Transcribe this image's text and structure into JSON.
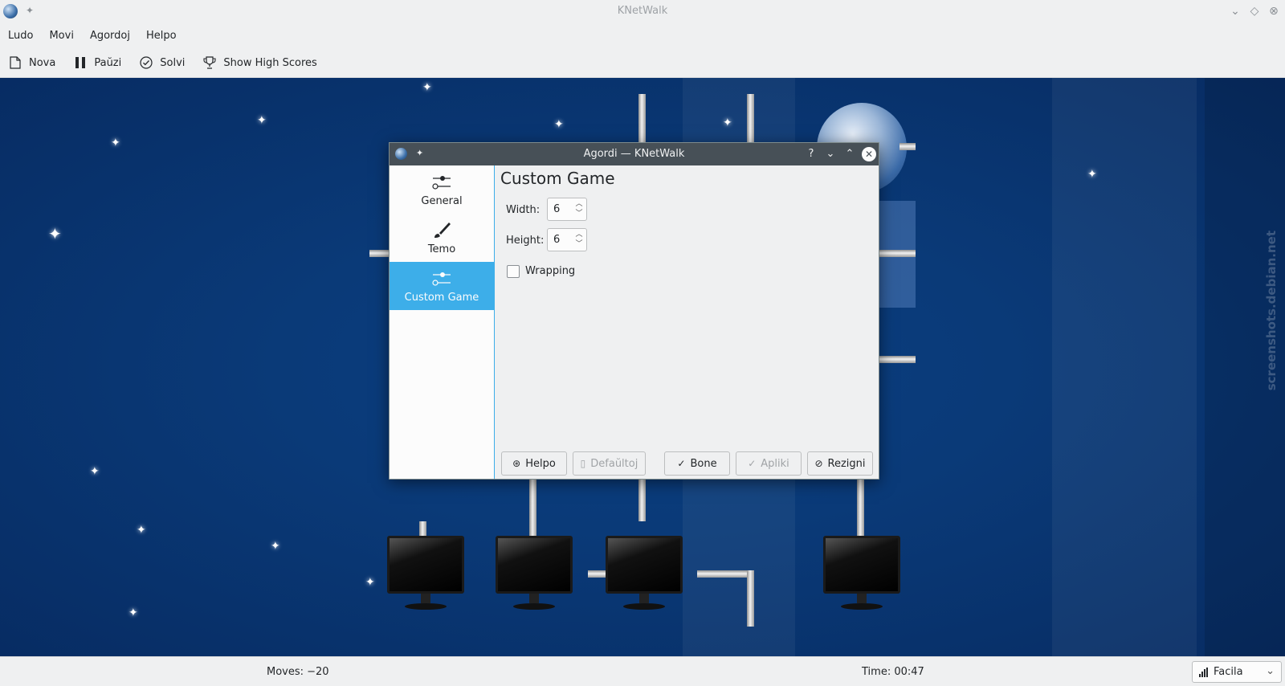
{
  "window": {
    "title": "KNetWalk"
  },
  "menubar": {
    "items": [
      "Ludo",
      "Movi",
      "Agordoj",
      "Helpo"
    ]
  },
  "toolbar": {
    "new_label": "Nova",
    "pause_label": "Paŭzi",
    "solve_label": "Solvi",
    "highscores_label": "Show High Scores"
  },
  "status": {
    "moves": "Moves: −20",
    "time": "Time: 00:47",
    "difficulty": "Facila"
  },
  "watermark": "screenshots.debian.net",
  "dialog": {
    "title": "Agordi — KNetWalk",
    "sidebar": [
      "General",
      "Temo",
      "Custom Game"
    ],
    "active_page": "Custom Game",
    "page_title": "Custom Game",
    "width_label": "Width:",
    "width_value": "6",
    "height_label": "Height:",
    "height_value": "6",
    "wrapping_label": "Wrapping",
    "wrapping_checked": false,
    "buttons": {
      "help": "Helpo",
      "defaults": "Defaŭltoj",
      "ok": "Bone",
      "apply": "Apliki",
      "cancel": "Rezigni"
    }
  },
  "colors": {
    "accent": "#3daee9",
    "titlebar_dark": "#475057",
    "background_blue": "#0a3a78"
  }
}
